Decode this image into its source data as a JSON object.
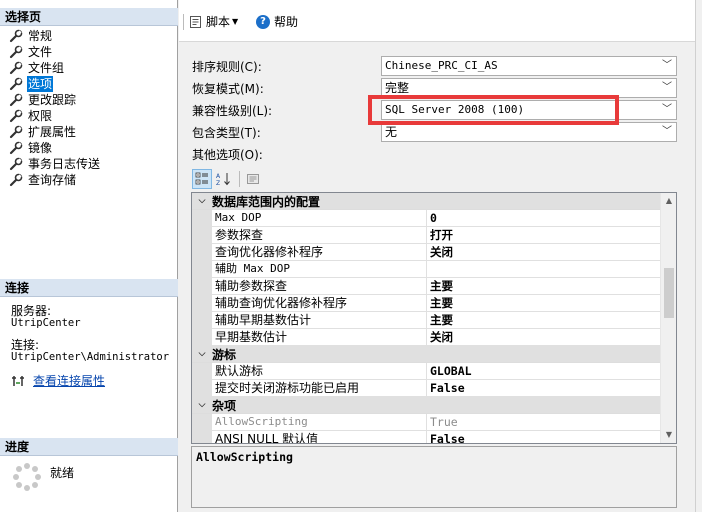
{
  "left_panel": {
    "select_page_title": "选择页",
    "pages": [
      {
        "label": "常规",
        "selected": false
      },
      {
        "label": "文件",
        "selected": false
      },
      {
        "label": "文件组",
        "selected": false
      },
      {
        "label": "选项",
        "selected": true
      },
      {
        "label": "更改跟踪",
        "selected": false
      },
      {
        "label": "权限",
        "selected": false
      },
      {
        "label": "扩展属性",
        "selected": false
      },
      {
        "label": "镜像",
        "selected": false
      },
      {
        "label": "事务日志传送",
        "selected": false
      },
      {
        "label": "查询存储",
        "selected": false
      }
    ],
    "connection_title": "连接",
    "server_label": "服务器:",
    "server_value": "UtripCenter",
    "connection_label": "连接:",
    "connection_value": "UtripCenter\\Administrator",
    "view_connection_link": "查看连接属性",
    "progress_title": "进度",
    "progress_status": "就绪"
  },
  "toolbar": {
    "script_label": "脚本",
    "help_label": "帮助"
  },
  "form": {
    "collation_label": "排序规则(C):",
    "collation_value": "Chinese_PRC_CI_AS",
    "recovery_label": "恢复模式(M):",
    "recovery_value": "完整",
    "compat_label": "兼容性级别(L):",
    "compat_value": "SQL Server 2008 (100)",
    "containment_label": "包含类型(T):",
    "containment_value": "无",
    "other_options_label": "其他选项(O):"
  },
  "property_grid": {
    "categories": [
      {
        "name": "数据库范围内的配置",
        "rows": [
          {
            "key": "Max DOP",
            "value": "0",
            "mono_key": true
          },
          {
            "key": "参数探查",
            "value": "打开"
          },
          {
            "key": "查询优化器修补程序",
            "value": "关闭"
          },
          {
            "key": "辅助 Max DOP",
            "value": "",
            "mono_key": true
          },
          {
            "key": "辅助参数探查",
            "value": "主要"
          },
          {
            "key": "辅助查询优化器修补程序",
            "value": "主要"
          },
          {
            "key": "辅助早期基数估计",
            "value": "主要"
          },
          {
            "key": "早期基数估计",
            "value": "关闭"
          }
        ]
      },
      {
        "name": "游标",
        "rows": [
          {
            "key": "默认游标",
            "value": "GLOBAL"
          },
          {
            "key": "提交时关闭游标功能已启用",
            "value": "False"
          }
        ]
      },
      {
        "name": "杂项",
        "rows": [
          {
            "key": "AllowScripting",
            "value": "True",
            "disabled": true,
            "mono_key": true
          },
          {
            "key": "ANSI NULL 默认值",
            "value": "False"
          }
        ]
      }
    ],
    "description": "AllowScripting"
  },
  "colors": {
    "selection": "#0078d7",
    "highlight_box": "#e83a3a",
    "section_header": "#d9e4f1",
    "link": "#0645ad"
  }
}
